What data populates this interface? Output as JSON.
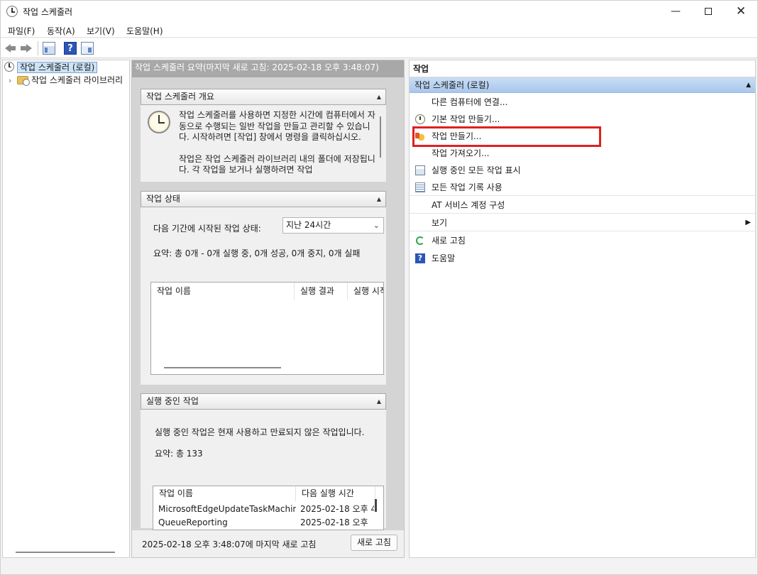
{
  "window": {
    "title": "작업 스케줄러"
  },
  "menu": [
    "파일(F)",
    "동작(A)",
    "보기(V)",
    "도움말(H)"
  ],
  "tree": {
    "root": "작업 스케줄러 (로컬)",
    "library": "작업 스케줄러 라이브러리"
  },
  "center": {
    "header": "작업 스케줄러 요약(마지막 새로 고침: 2025-02-18 오후 3:48:07)",
    "overview": {
      "title": "작업 스케줄러 개요",
      "para1": "작업 스케줄러를 사용하면 지정한 시간에 컴퓨터에서 자동으로 수행되는 일반 작업을 만들고 관리할 수 있습니다. 시작하려면 [작업] 창에서 명령을 클릭하십시오.",
      "para2": "작업은 작업 스케줄러 라이브러리 내의 폴더에 저장됩니다. 각 작업을 보거나 실행하려면 작업"
    },
    "status": {
      "title": "작업 상태",
      "period_label": "다음 기간에 시작된 작업 상태:",
      "period_value": "지난 24시간",
      "summary": "요약: 총 0개 - 0개 실행 중, 0개 성공, 0개 중지, 0개 실패",
      "columns": [
        "작업 이름",
        "실행 결과",
        "실행 시작"
      ]
    },
    "running": {
      "title": "실행 중인 작업",
      "description": "실행 중인 작업은 현재 사용하고 만료되지 않은 작업입니다.",
      "summary": "요약: 총 133",
      "columns": [
        "작업 이름",
        "다음 실행 시간"
      ],
      "rows": [
        [
          "MicrosoftEdgeUpdateTaskMachin...",
          "2025-02-18 오후 4"
        ],
        [
          "QueueReporting",
          "2025-02-18 오후"
        ]
      ]
    },
    "footer": {
      "last_refresh": "2025-02-18 오후 3:48:07에 마지막 새로 고침",
      "refresh_button": "새로 고침"
    }
  },
  "actions": {
    "title": "작업",
    "group": "작업 스케줄러 (로컬)",
    "items": [
      "다른 컴퓨터에 연결...",
      "기본 작업 만들기...",
      "작업 만들기...",
      "작업 가져오기...",
      "실행 중인 모든 작업 표시",
      "모든 작업 기록 사용",
      "AT 서비스 계정 구성",
      "보기",
      "새로 고침",
      "도움말"
    ]
  },
  "colors": {
    "highlight": "#e02020",
    "action_group": "#b9d3f0"
  }
}
